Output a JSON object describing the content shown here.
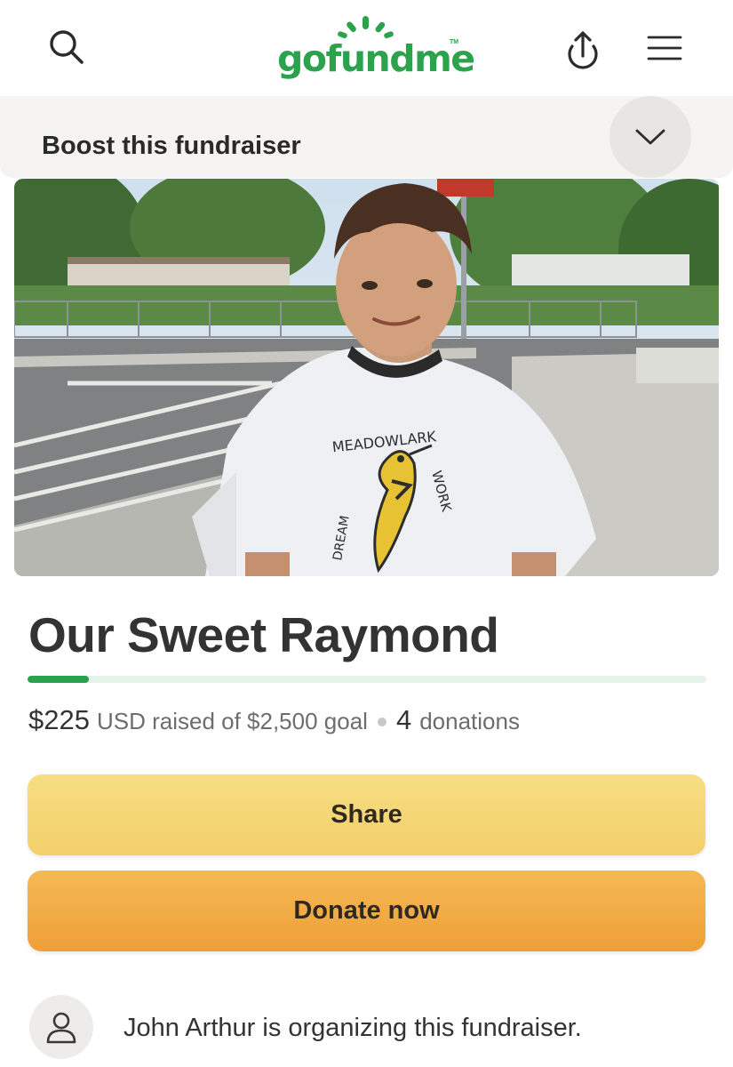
{
  "header": {
    "logo_text": "gofundme",
    "logo_tm": "TM",
    "icons": [
      "search-icon",
      "upload-share-icon",
      "hamburger-menu-icon"
    ]
  },
  "boost": {
    "label": "Boost this fundraiser",
    "toggle_icon": "chevron-down-icon"
  },
  "photo": {
    "shirt_text": "MEADOWLARK",
    "shirt_side_left": "DREAM",
    "shirt_side_right": "WORK"
  },
  "fundraiser": {
    "title": "Our Sweet Raymond",
    "raised_amount": "$225",
    "raised_suffix": "USD raised of $2,500 goal",
    "donation_count": "4",
    "donation_label": "donations",
    "progress_fraction": 0.09
  },
  "actions": {
    "share_label": "Share",
    "donate_label": "Donate now"
  },
  "organizer": {
    "text": "John Arthur is organizing this fundraiser.",
    "avatar_icon": "user-icon"
  },
  "colors": {
    "brand_green": "#2da24d",
    "share_yellow": "#f3cf69",
    "donate_orange": "#ef9f38",
    "boost_bg": "#f5f4f2"
  }
}
